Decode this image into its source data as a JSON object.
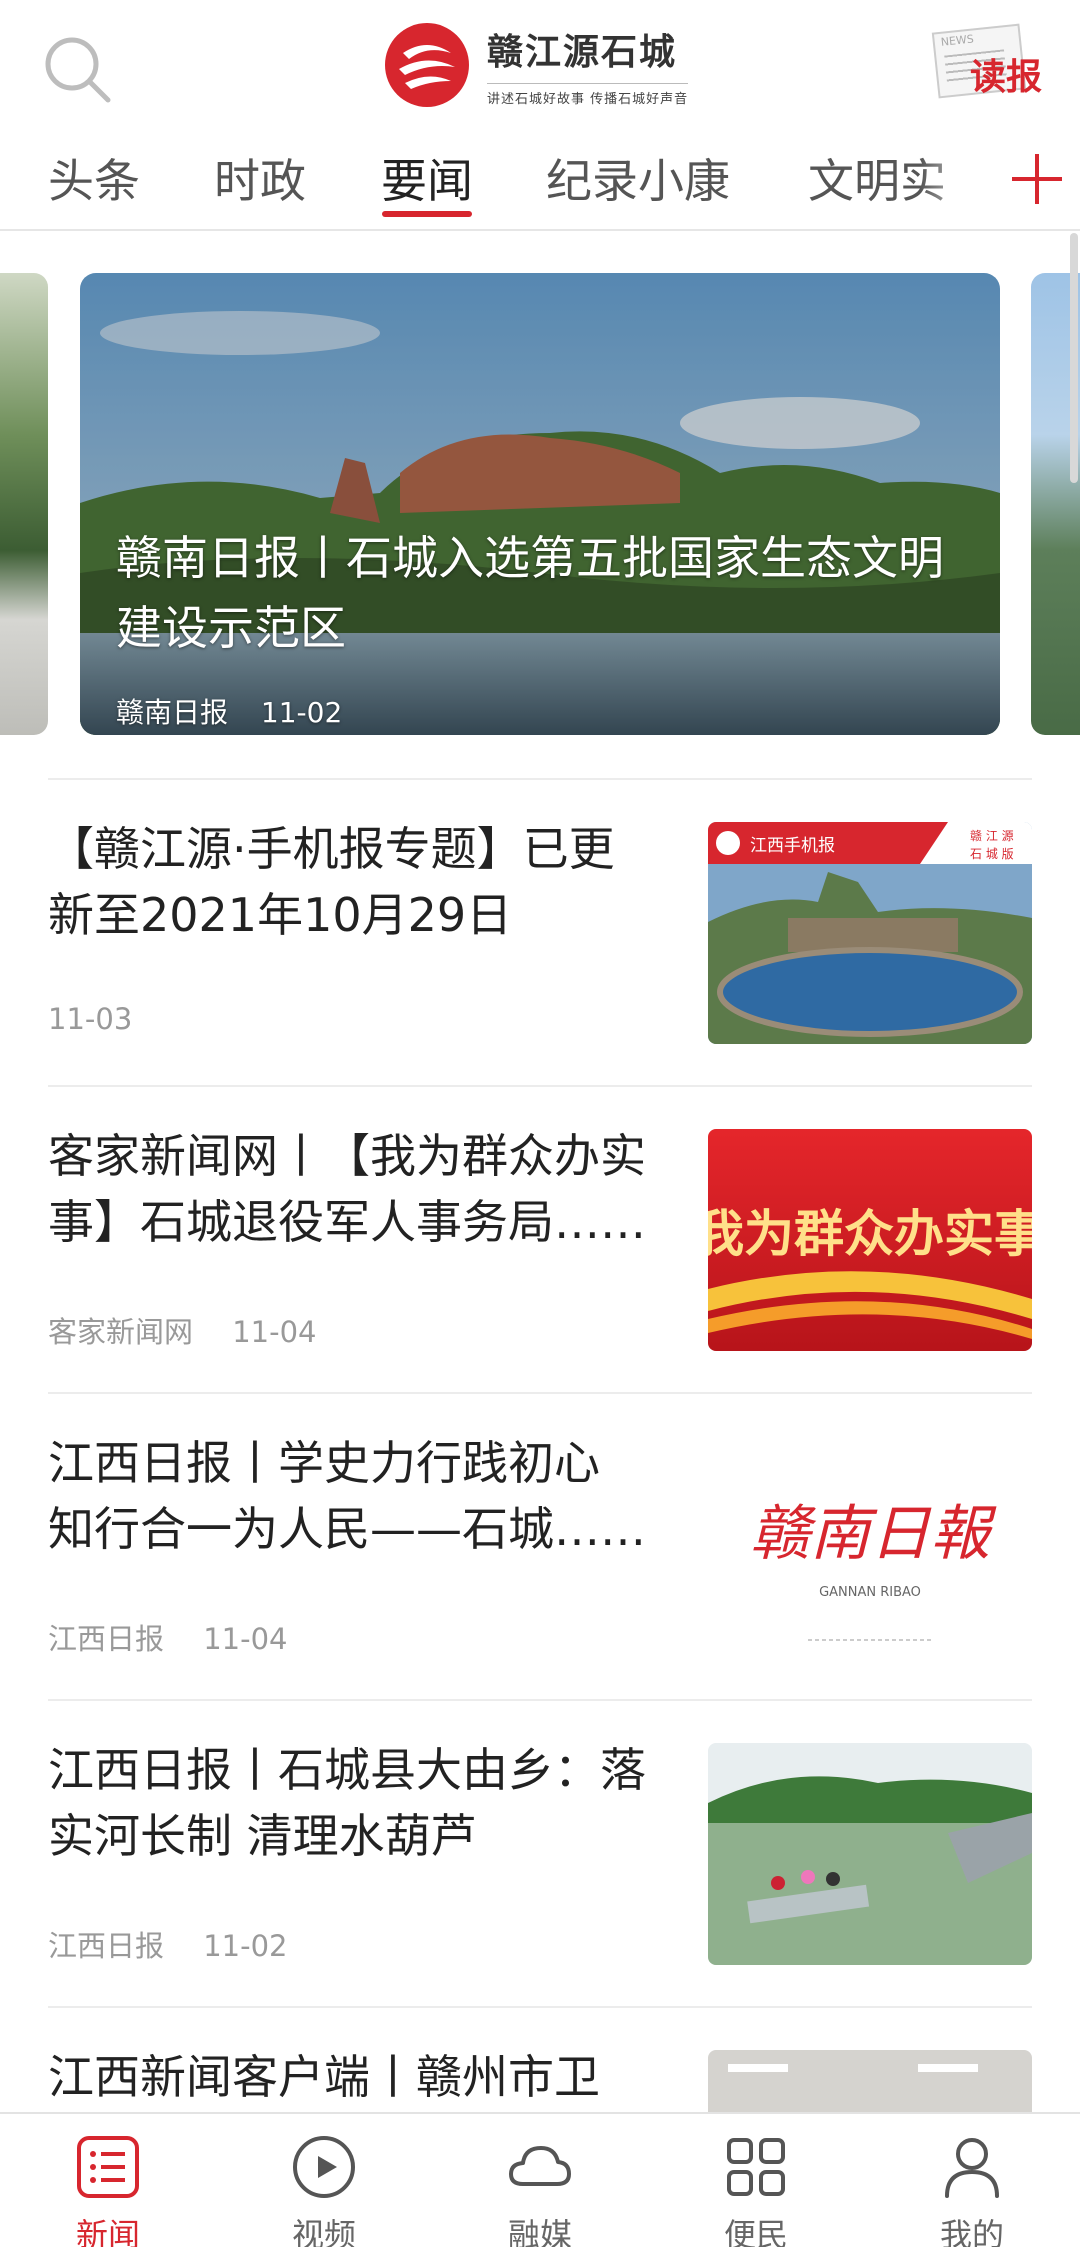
{
  "header": {
    "logo_title": "赣江源石城",
    "logo_slogan": "讲述石城好故事 传播石城好声音",
    "read_paper_label": "读报",
    "colors": {
      "brand": "#d7262e"
    }
  },
  "tabs": [
    {
      "label": "头条"
    },
    {
      "label": "时政"
    },
    {
      "label": "要闻",
      "active": true
    },
    {
      "label": "纪录小康"
    },
    {
      "label": "文明实"
    }
  ],
  "carousel": {
    "title": "赣南日报丨石城入选第五批国家生态文明建设示范区",
    "source": "赣南日报",
    "date": "11-02"
  },
  "news": [
    {
      "title": "【赣江源·手机报专题】已更新至2021年10月29日",
      "source": "",
      "date": "11-03",
      "thumb_text": "江西手机报",
      "thumb_badge": "赣江源 石城版"
    },
    {
      "title": "客家新闻网丨【我为群众办实事】石城退役军人事务局……",
      "source": "客家新闻网",
      "date": "11-04",
      "thumb_text": "我为群众办实事"
    },
    {
      "title": "江西日报丨学史力行践初心 知行合一为人民——石城……",
      "source": "江西日报",
      "date": "11-04",
      "thumb_text": "赣南日報",
      "thumb_subtext": "GANNAN RIBAO"
    },
    {
      "title": "江西日报丨石城县大由乡：落实河长制 清理水葫芦",
      "source": "江西日报",
      "date": "11-02"
    },
    {
      "title": "江西新闻客户端丨赣州市卫",
      "source": "",
      "date": ""
    }
  ],
  "bottom_nav": [
    {
      "label": "新闻",
      "icon": "news-list-icon",
      "active": true
    },
    {
      "label": "视频",
      "icon": "play-icon"
    },
    {
      "label": "融媒",
      "icon": "cloud-icon"
    },
    {
      "label": "便民",
      "icon": "grid-icon"
    },
    {
      "label": "我的",
      "icon": "user-icon"
    }
  ]
}
